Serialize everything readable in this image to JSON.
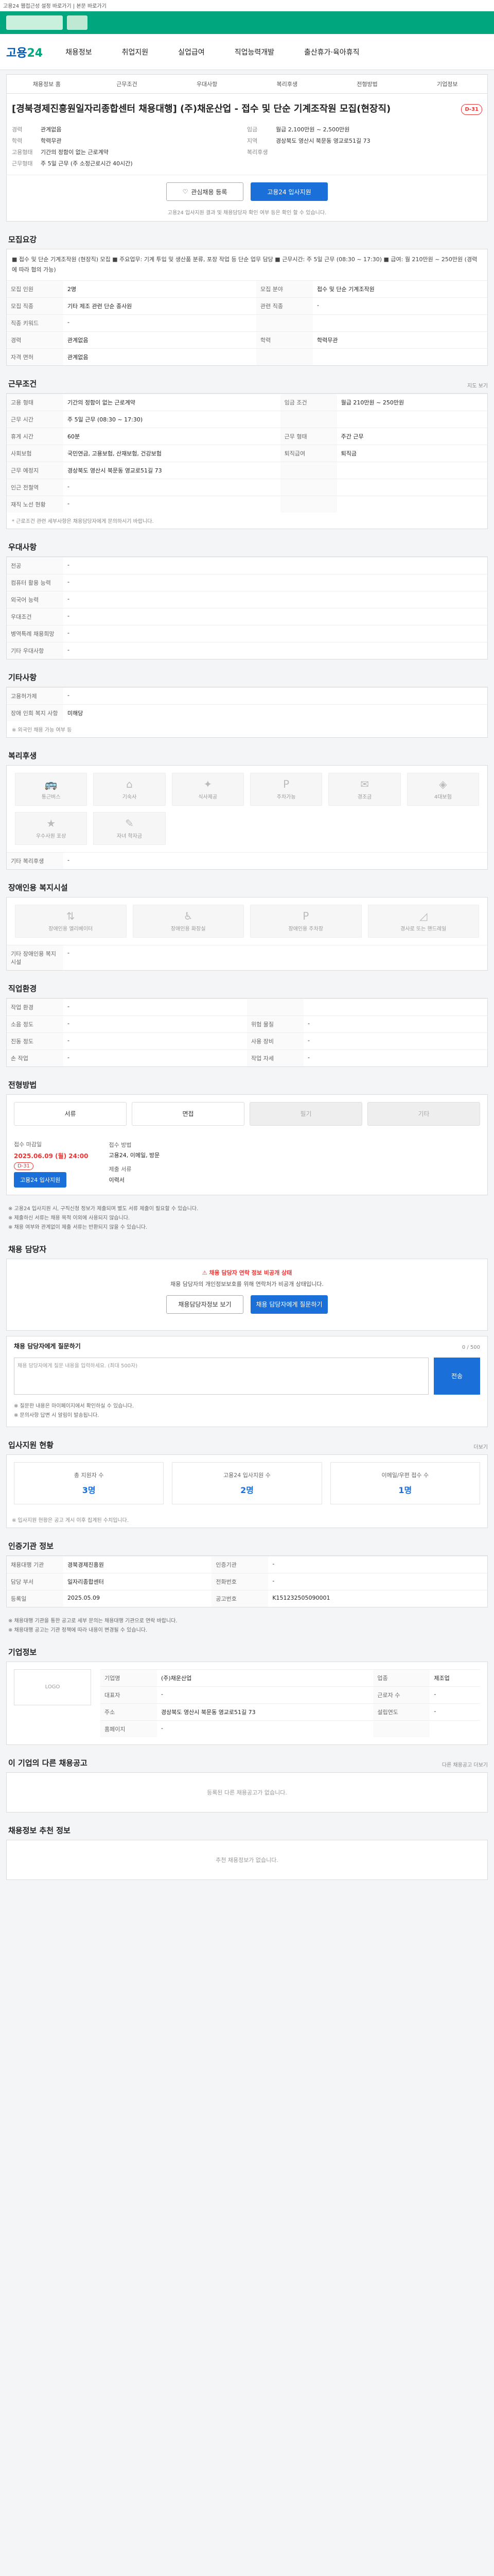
{
  "topbar": {
    "text": "고용24 웹접근성 설정 바로가기 | 본문 바로가기"
  },
  "nav": {
    "logo_main": "고용",
    "logo_num": "24",
    "items": [
      "채용정보",
      "취업지원",
      "실업급여",
      "직업능력개발",
      "출산휴가·육아휴직"
    ]
  },
  "sub_tabs": [
    "채용정보 홈",
    "근무조건",
    "우대사항",
    "복리후생",
    "전형방법",
    "기업정보"
  ],
  "job": {
    "title": "[경북경제진흥원일자리종합센터 채용대행] (주)채운산업 - 접수 및 단순 기계조작원 모집(현장직)",
    "dday": "D-31",
    "left": [
      {
        "k": "경력",
        "v": "관계없음"
      },
      {
        "k": "학력",
        "v": "학력무관"
      },
      {
        "k": "고용형태",
        "v": "기간의 정함이 없는 근로계약"
      },
      {
        "k": "근무형태",
        "v": "주 5일 근무 (주 소정근로시간 40시간)"
      }
    ],
    "right": [
      {
        "k": "임금",
        "v": "월급 2,100만원 ~ 2,500만원"
      },
      {
        "k": "지역",
        "v": "경상북도 영산시 북문동 영교로51길 73"
      },
      {
        "k": "복리후생",
        "v": ""
      }
    ]
  },
  "buttons": {
    "like": "관심채용 등록",
    "apply": "고용24 입사지원"
  },
  "apply_note": "고용24 입사지원 결과 및 채용담당자 확인 여부 등은 확인 할 수 있습니다.",
  "sections": {
    "recruit": "모집요강",
    "conditions": "근무조건",
    "preference": "우대사항",
    "other_req": "기타사항",
    "welfare": "복리후생",
    "disabled": "장애인용 복지시설",
    "selection": "직업환경",
    "process": "전형방법",
    "contact": "채용 담당자",
    "inquiry": "채용 담당자에게 질문하기",
    "status": "입사지원 현황",
    "company_detail": "인증기관 정보",
    "company": "기업정보",
    "same_company": "이 기업의 다른 채용공고",
    "similar": "채용정보 추천 정보"
  },
  "job_desc": "■ 접수 및 단순 기계조작원 (현장직) 모집 ■ 주요업무: 기계 투입 및 생산품 분류, 포장 작업 등 단순 업무 담당 ■ 근무시간: 주 5일 근무 (08:30 ~ 17:30) ■ 급여: 월 210만원 ~ 250만원 (경력에 따라 협의 가능)",
  "recruit_table": [
    {
      "k": "모집 인원",
      "v": "2명",
      "k2": "모집 분야",
      "v2": "접수 및 단순 기계조작원"
    },
    {
      "k": "모집 직종",
      "v": "기타 제조 관련 단순 종사원",
      "k2": "관련 직종",
      "v2": "-"
    },
    {
      "k": "직종 키워드",
      "v": "-",
      "k2": "",
      "v2": ""
    },
    {
      "k": "경력",
      "v": "관계없음",
      "k2": "학력",
      "v2": "학력무관"
    },
    {
      "k": "자격 면허",
      "v": "관계없음",
      "k2": "",
      "v2": ""
    }
  ],
  "cond_table": [
    {
      "k": "고용 형태",
      "v": "기간의 정함이 없는 근로계약",
      "k2": "임금 조건",
      "v2": "월급 210만원 ~ 250만원"
    },
    {
      "k": "근무 시간",
      "v": "주 5일 근무 (08:30 ~ 17:30)",
      "k2": "",
      "v2": ""
    },
    {
      "k": "휴게 시간",
      "v": "60분",
      "k2": "근무 형태",
      "v2": "주간 근무"
    },
    {
      "k": "사회보험",
      "v": "국민연금, 고용보험, 산재보험, 건강보험",
      "k2": "퇴직급여",
      "v2": "퇴직금"
    },
    {
      "k": "근무 예정지",
      "v": "경상북도 영산시 북문동 영교로51길 73",
      "k2": "",
      "v2": ""
    },
    {
      "k": "인근 전철역",
      "v": "-",
      "k2": "",
      "v2": ""
    },
    {
      "k": "재직 노선 현황",
      "v": "-",
      "k2": "",
      "v2": ""
    }
  ],
  "cond_note": "* 근로조건 관련 세부사항은 채용담당자에게 문의하시기 바랍니다.",
  "map_btn": "지도 보기",
  "pref_table": [
    {
      "k": "전공",
      "v": "-"
    },
    {
      "k": "컴퓨터 활용 능력",
      "v": "-"
    },
    {
      "k": "외국어 능력",
      "v": "-"
    },
    {
      "k": "우대조건",
      "v": "-"
    },
    {
      "k": "병역특례 채용희망",
      "v": "-"
    },
    {
      "k": "기타 우대사항",
      "v": "-"
    }
  ],
  "other_table": [
    {
      "k": "고용허가제",
      "v": "-"
    },
    {
      "k": "장애 인희 복지 사항",
      "v": "미해당"
    }
  ],
  "other_note": "※ 외국인 채용 가능 여부 등",
  "welfare_items": [
    "통근버스",
    "기숙사",
    "식사제공",
    "주차가능",
    "경조금",
    "4대보험",
    "우수사원 포상",
    "자녀 학자금"
  ],
  "welfare_extra_label": "기타 복리후생",
  "welfare_extra_value": "-",
  "disabled_items": [
    "장애인용 엘리베이터",
    "장애인용 화장실",
    "장애인용 주차장",
    "경사로 또는 핸드레일"
  ],
  "disabled_extra_label": "기타 장애인용 복지시설",
  "disabled_extra_value": "-",
  "env_table": [
    {
      "k": "작업 환경",
      "v": "-",
      "k2": "",
      "v2": ""
    },
    {
      "k": "소음 정도",
      "v": "-",
      "k2": "위험 물질",
      "v2": "-"
    },
    {
      "k": "진동 정도",
      "v": "-",
      "k2": "사용 장비",
      "v2": "-"
    },
    {
      "k": "손 작업",
      "v": "-",
      "k2": "작업 자세",
      "v2": "-"
    }
  ],
  "process_chips": [
    "서류",
    "면접",
    "필기",
    "기타"
  ],
  "process_info": {
    "deadline_label": "접수 마감일",
    "deadline_value": "2025.06.09 (월) 24:00",
    "dday": "D-31",
    "apply_btn": "고용24 입사지원",
    "method_label": "접수 방법",
    "method_value": "고용24, 이메일, 방문",
    "docs_label": "제출 서류",
    "docs_value": "이력서"
  },
  "process_notes": [
    "※ 고용24 입사지원 시, 구직신청 정보가 제출되며 별도 서류 제출이 필요할 수 있습니다.",
    "※ 제출하신 서류는 채용 목적 이외에 사용되지 않습니다.",
    "※ 채용 여부와 관계없이 제출 서류는 반환되지 않을 수 있습니다."
  ],
  "contact": {
    "warn": "채용 담당자 연락 정보 비공개 상태",
    "desc": "채용 담당자의 개인정보보호를 위해 연락처가 비공개 상태입니다.",
    "btn_outline": "채용담당자정보 보기",
    "btn_primary": "채용 담당자에게 질문하기"
  },
  "inquiry": {
    "placeholder": "채용 담당자에게 질문 내용을 입력하세요. (최대 500자)",
    "counter": "0 / 500",
    "send": "전송",
    "notes": [
      "※ 질문한 내용은 마이페이지에서 확인하실 수 있습니다.",
      "※ 문의사항 답변 시 알림이 발송됩니다."
    ]
  },
  "status": {
    "more": "더보기",
    "stats": [
      {
        "lbl": "총 지원자 수",
        "num": "3명"
      },
      {
        "lbl": "고용24 입사지원 수",
        "num": "2명"
      },
      {
        "lbl": "이메일/우편 접수 수",
        "num": "1명"
      }
    ],
    "note": "※ 입사지원 현황은 공고 게시 이후 집계된 수치입니다."
  },
  "agency_table": [
    {
      "k": "채용대행 기관",
      "v": "경북경제진흥원",
      "k2": "인증기관",
      "v2": "-"
    },
    {
      "k": "담당 부서",
      "v": "일자리종합센터",
      "k2": "전화번호",
      "v2": "-"
    },
    {
      "k": "등록일",
      "v": "2025.05.09",
      "k2": "공고번호",
      "v2": "K151232505090001"
    }
  ],
  "agency_notes": [
    "※ 채용대행 기관을 통한 공고로 세부 문의는 채용대행 기관으로 연락 바랍니다.",
    "※ 채용대행 공고는 기관 정책에 따라 내용이 변경될 수 있습니다."
  ],
  "company": {
    "logo": "LOGO",
    "rows": [
      {
        "k": "기업명",
        "v": "(주)채운산업",
        "k2": "업종",
        "v2": "제조업"
      },
      {
        "k": "대표자",
        "v": "-",
        "k2": "근로자 수",
        "v2": "-"
      },
      {
        "k": "주소",
        "v": "경상북도 영산시 북문동 영교로51길 73",
        "k2": "설립연도",
        "v2": "-"
      },
      {
        "k": "홈페이지",
        "v": "-",
        "k2": "",
        "v2": ""
      }
    ]
  },
  "same_company": {
    "more": "다른 채용공고 더보기",
    "empty": "등록된 다른 채용공고가 없습니다."
  },
  "similar": {
    "empty": "추천 채용정보가 없습니다."
  }
}
